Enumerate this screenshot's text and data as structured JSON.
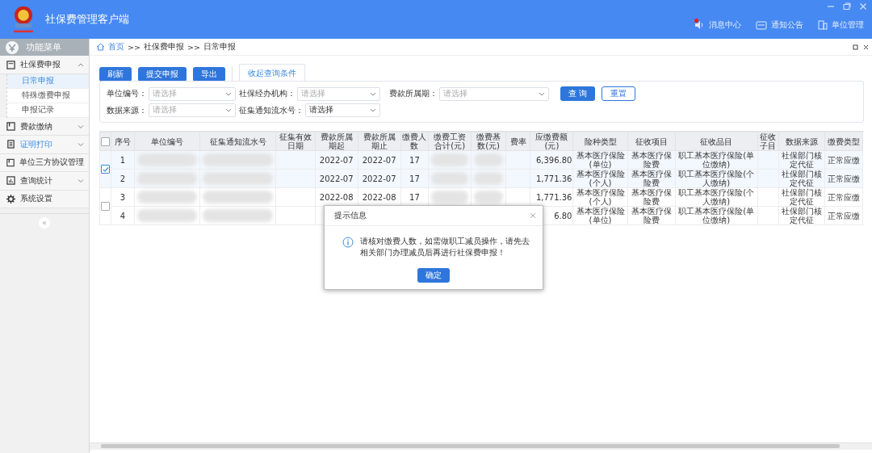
{
  "app": {
    "title": "社保费管理客户端"
  },
  "top_nav": [
    {
      "kind": "speaker",
      "label": "消息中心",
      "unread": true
    },
    {
      "kind": "mail",
      "label": "通知公告",
      "unread": false
    },
    {
      "kind": "building",
      "label": "单位管理",
      "unread": false
    }
  ],
  "sidebar": {
    "title": "功能菜单",
    "items": [
      {
        "kind": "doc",
        "label": "社保费申报",
        "expanded": true,
        "highlighted": false,
        "children": [
          {
            "label": "日常申报",
            "selected": true
          },
          {
            "label": "特殊缴费申报",
            "selected": false
          },
          {
            "label": "申报记录",
            "selected": false
          }
        ]
      },
      {
        "kind": "book",
        "label": "费款缴纳",
        "expanded": false,
        "highlighted": false,
        "has_children": true
      },
      {
        "kind": "print",
        "label": "证明打印",
        "expanded": false,
        "highlighted": true,
        "has_children": true
      },
      {
        "kind": "book",
        "label": "单位三方协议管理",
        "expanded": false,
        "highlighted": false,
        "has_children": false
      },
      {
        "kind": "chart",
        "label": "查询统计",
        "expanded": false,
        "highlighted": false,
        "has_children": true
      },
      {
        "kind": "gear",
        "label": "系统设置",
        "expanded": false,
        "highlighted": false,
        "has_children": false
      }
    ],
    "collapse": "«"
  },
  "breadcrumb": [
    "首页",
    ">>",
    "社保费申报",
    ">>",
    "日常申报"
  ],
  "toolbar": {
    "buttons": [
      "刷新",
      "提交申报",
      "导出"
    ],
    "tab": "收起查询条件"
  },
  "query": {
    "fields": [
      {
        "label": "单位编号：",
        "placeholder": "请选择"
      },
      {
        "label": "社保经办机构：",
        "placeholder": "请选择"
      },
      {
        "label": "费款所属期：",
        "placeholder": "请选择"
      },
      {
        "label": "数据来源：",
        "placeholder": "请选择"
      },
      {
        "label": "征集通知流水号：",
        "value": "请选择"
      }
    ],
    "buttons": [
      {
        "label": "查 询",
        "primary": true
      },
      {
        "label": "重置",
        "primary": false
      }
    ]
  },
  "table": {
    "all_checked": false,
    "columns": [
      {
        "label": "序号",
        "redacted": false
      },
      {
        "label": "单位编号",
        "redacted": true
      },
      {
        "label": "征集通知流水号",
        "redacted": true
      },
      {
        "label": "征集有效日期",
        "redacted": false
      },
      {
        "label": "费款所属期起",
        "redacted": false
      },
      {
        "label": "费款所属期止",
        "redacted": false
      },
      {
        "label": "缴费人数",
        "redacted": false
      },
      {
        "label": "缴费工资合计(元)",
        "redacted": true
      },
      {
        "label": "缴费基数(元)",
        "redacted": true
      },
      {
        "label": "费率",
        "redacted": false
      },
      {
        "label": "应缴费额(元)",
        "redacted": false
      },
      {
        "label": "险种类型",
        "redacted": false
      },
      {
        "label": "征收项目",
        "redacted": false
      },
      {
        "label": "征收品目",
        "redacted": false
      },
      {
        "label": "征收子目",
        "redacted": false
      },
      {
        "label": "数据来源",
        "redacted": false
      },
      {
        "label": "缴费类型",
        "redacted": false
      }
    ],
    "groups": [
      {
        "checked": true,
        "rows": [
          {
            "cells": [
              "1",
              "",
              "",
              "",
              "2022-07",
              "2022-07",
              "17",
              "",
              "",
              "",
              "6,396.80",
              "基本医疗保险(单位)",
              "基本医疗保险费",
              "职工基本医疗保险(单位缴纳)",
              "",
              "社保部门核定代征",
              "正常应缴"
            ]
          },
          {
            "cells": [
              "2",
              "",
              "",
              "",
              "2022-07",
              "2022-07",
              "17",
              "",
              "",
              "",
              "1,771.36",
              "基本医疗保险(个人)",
              "基本医疗保险费",
              "职工基本医疗保险(个人缴纳)",
              "",
              "社保部门核定代征",
              "正常应缴"
            ]
          }
        ]
      },
      {
        "checked": false,
        "rows": [
          {
            "cells": [
              "3",
              "",
              "",
              "",
              "2022-08",
              "2022-08",
              "17",
              "",
              "",
              "",
              "1,771.36",
              "基本医疗保险(个人)",
              "基本医疗保险费",
              "职工基本医疗保险(个人缴纳)",
              "",
              "社保部门核定代征",
              "正常应缴"
            ]
          },
          {
            "cells": [
              "4",
              "",
              "",
              "",
              "",
              "",
              "",
              "",
              "",
              "",
              "6.80",
              "基本医疗保险(单位)",
              "基本医疗保险费",
              "职工基本医疗保险(单位缴纳)",
              "",
              "社保部门核定代征",
              "正常应缴"
            ]
          }
        ]
      }
    ]
  },
  "dialog": {
    "title": "提示信息",
    "message": "请核对缴费人数，如需做职工减员操作，请先去相关部门办理减员后再进行社保费申报！",
    "button": "确定"
  }
}
